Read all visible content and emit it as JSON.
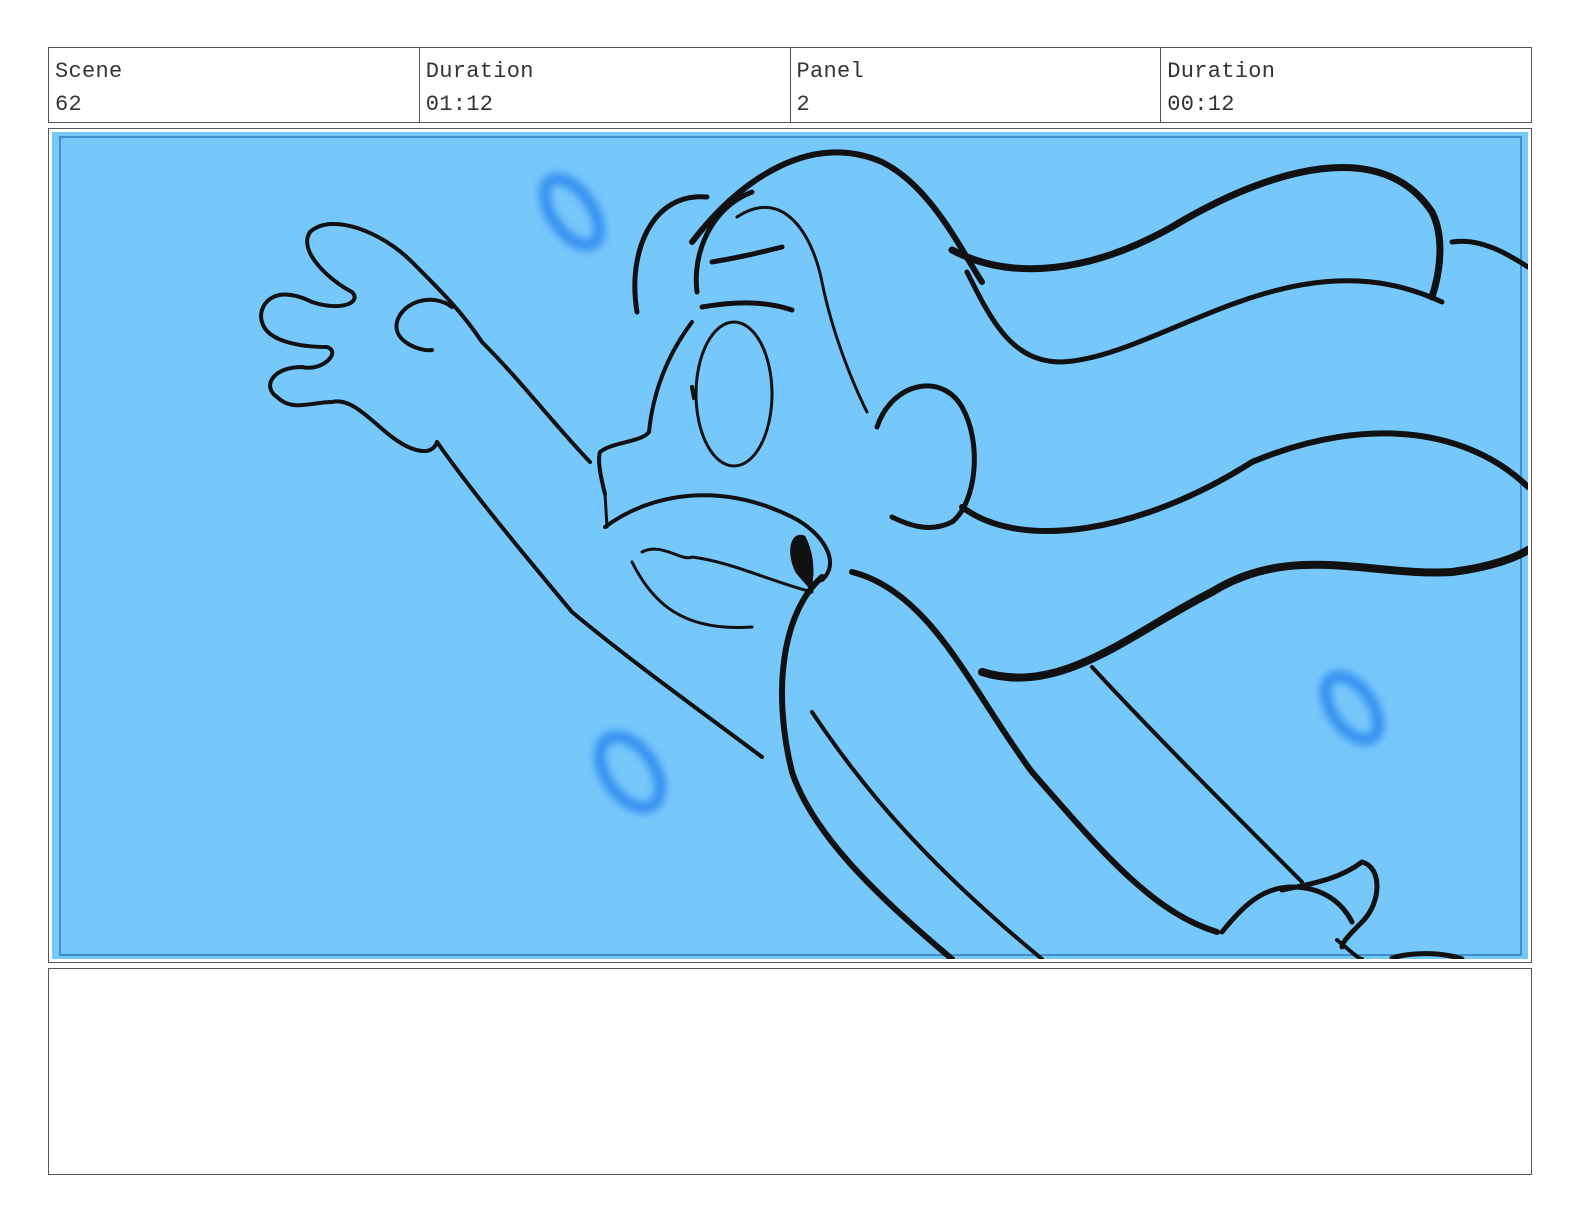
{
  "header": {
    "scene": {
      "label": "Scene",
      "value": "62"
    },
    "scene_duration": {
      "label": "Duration",
      "value": "01:12"
    },
    "panel": {
      "label": "Panel",
      "value": "2"
    },
    "panel_duration": {
      "label": "Duration",
      "value": "00:12"
    }
  },
  "panel_image": {
    "colors": {
      "background": "#76c8fb",
      "inner_border": "#3f8ecf",
      "bubble": "#2f86ee",
      "line": "#111111"
    }
  },
  "notes": {
    "text": ""
  }
}
